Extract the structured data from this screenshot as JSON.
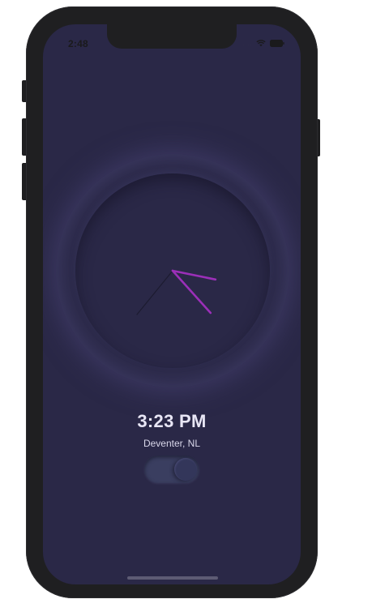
{
  "status_bar": {
    "time": "2:48",
    "signal": "....",
    "wifi_icon": "wifi-icon",
    "battery_icon": "battery-icon"
  },
  "clock": {
    "time": "3:23 PM",
    "location": "Deventer, NL",
    "hour": 3,
    "minute": 23,
    "accent_color": "#9b2fb8",
    "background_color": "#2a2847"
  },
  "theme_toggle": {
    "on": true
  }
}
